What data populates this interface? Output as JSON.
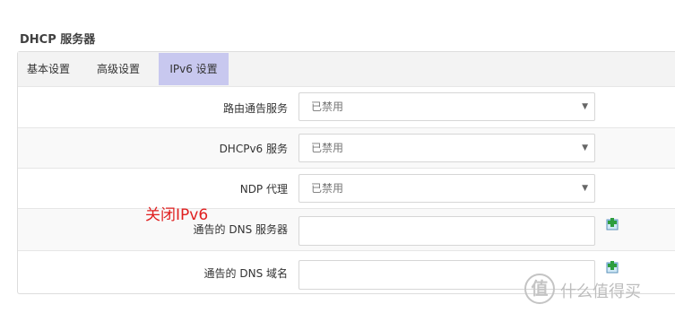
{
  "section": {
    "title": "DHCP 服务器"
  },
  "tabs": [
    {
      "label": "基本设置",
      "active": false
    },
    {
      "label": "高级设置",
      "active": false
    },
    {
      "label": "IPv6 设置",
      "active": true
    }
  ],
  "rows": [
    {
      "label": "路由通告服务",
      "type": "select",
      "value": "已禁用"
    },
    {
      "label": "DHCPv6 服务",
      "type": "select",
      "value": "已禁用"
    },
    {
      "label": "NDP 代理",
      "type": "select",
      "value": "已禁用"
    },
    {
      "label": "通告的 DNS 服务器",
      "type": "text",
      "value": "",
      "action_icon": "add-icon"
    },
    {
      "label": "通告的 DNS 域名",
      "type": "text",
      "value": "",
      "action_icon": "add-icon"
    }
  ],
  "annotation": {
    "text": "关闭IPv6",
    "color": "#e02020"
  },
  "watermark": {
    "logo_char": "值",
    "text": "什么值得买"
  },
  "colors": {
    "active_tab": "#c8c8ef",
    "tab_bar": "#f3f3f3",
    "border": "#dddddd"
  }
}
